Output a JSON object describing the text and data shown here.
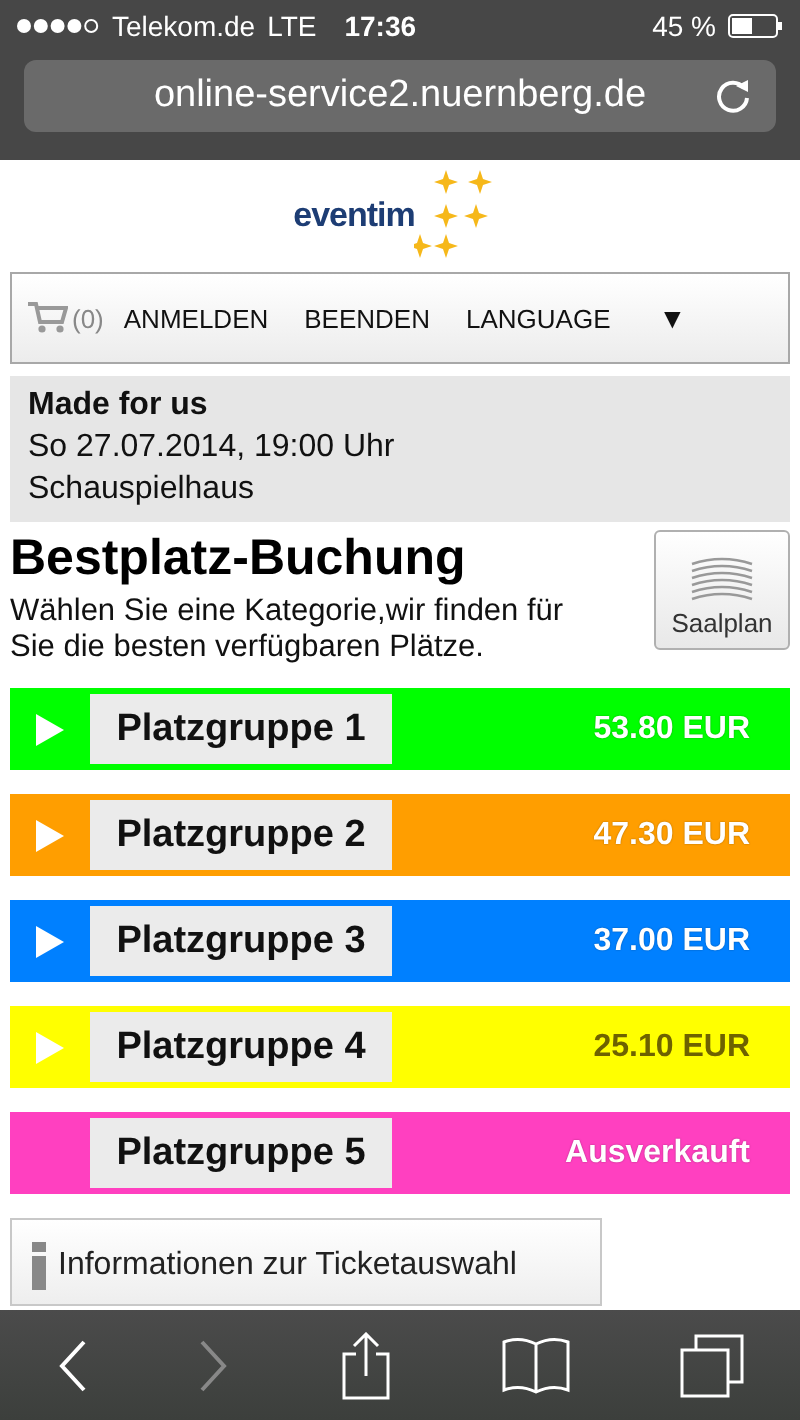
{
  "status_bar": {
    "carrier": "Telekom.de",
    "network": "LTE",
    "time": "17:36",
    "battery": "45 %"
  },
  "address_bar": {
    "url": "online-service2.nuernberg.de"
  },
  "logo": {
    "text": "eventim"
  },
  "nav": {
    "cart_count": "(0)",
    "items": [
      "ANMELDEN",
      "BEENDEN",
      "LANGUAGE"
    ],
    "menu_toggle": "▼"
  },
  "event": {
    "title": "Made for us",
    "date": "So 27.07.2014, 19:00 Uhr",
    "venue": "Schauspielhaus"
  },
  "heading": "Bestplatz-Buchung",
  "description": "Wählen Sie eine Kategorie,wir finden für Sie die besten verfügbaren Plätze.",
  "seat_plan_button": "Saalplan",
  "categories": [
    {
      "label": "Platzgruppe 1",
      "price": "53.80 EUR",
      "available": true,
      "color": "#00ff00"
    },
    {
      "label": "Platzgruppe 2",
      "price": "47.30 EUR",
      "available": true,
      "color": "#ff9e00"
    },
    {
      "label": "Platzgruppe 3",
      "price": "37.00 EUR",
      "available": true,
      "color": "#0080ff"
    },
    {
      "label": "Platzgruppe 4",
      "price": "25.10 EUR",
      "available": true,
      "color": "#ffff00"
    },
    {
      "label": "Platzgruppe 5",
      "price": "Ausverkauft",
      "available": false,
      "color": "#ff40c0"
    }
  ],
  "info_button": "Informationen zur Ticketauswahl",
  "toolbar": {
    "back_disabled": false,
    "forward_disabled": true
  }
}
